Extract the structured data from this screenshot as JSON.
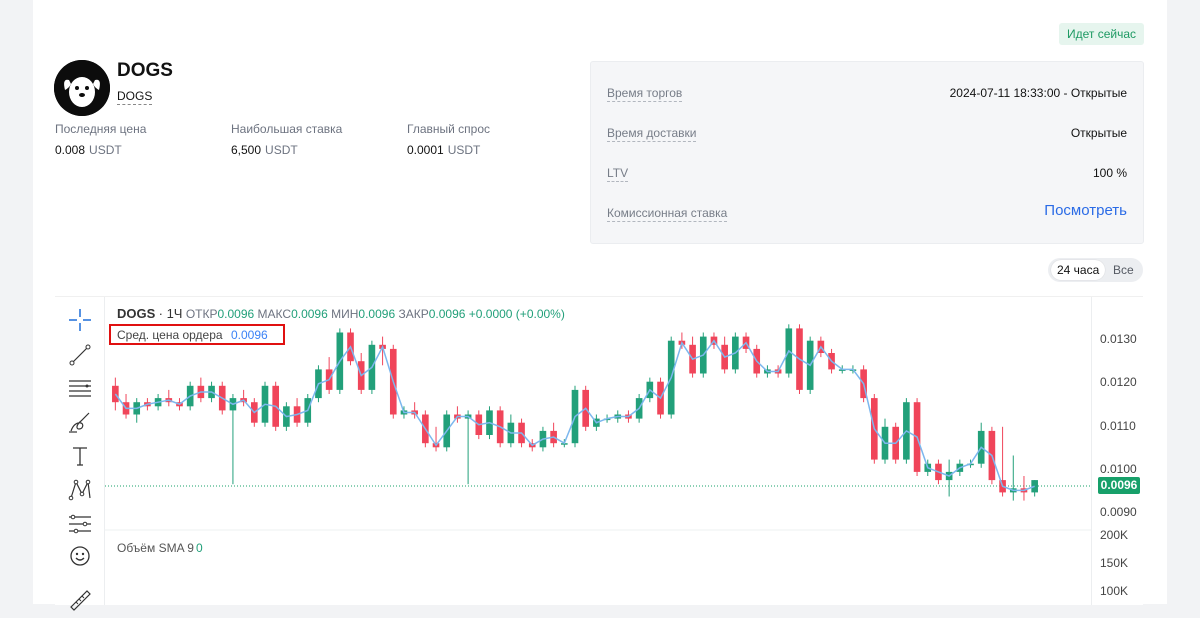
{
  "header": {
    "live_badge": "Идет сейчас",
    "token_name": "DOGS",
    "token_symbol": "DOGS"
  },
  "stats": [
    {
      "label": "Последняя цена",
      "value": "0.008",
      "unit": "USDT"
    },
    {
      "label": "Наибольшая ставка",
      "value": "6,500",
      "unit": "USDT"
    },
    {
      "label": "Главный спрос",
      "value": "0.0001",
      "unit": "USDT"
    }
  ],
  "info": {
    "trade_time_label": "Время торгов",
    "trade_time_value": "2024-07-11 18:33:00 - Открытые",
    "delivery_label": "Время доставки",
    "delivery_value": "Открытые",
    "ltv_label": "LTV",
    "ltv_value": "100 %",
    "fee_label": "Комиссионная ставка",
    "fee_link": "Посмотреть"
  },
  "range": {
    "options": [
      "24 часа",
      "Все"
    ],
    "selected": "24 часа"
  },
  "toolbar": {
    "icons": [
      "crosshair-icon",
      "trend-line-icon",
      "horizontal-lines-icon",
      "brush-icon",
      "text-icon",
      "pattern-icon",
      "forecast-icon",
      "emoji-icon",
      "ruler-icon"
    ]
  },
  "chart": {
    "symbol": "DOGS",
    "timeframe": "· 1Ч",
    "open_label": "ОТКР",
    "open": "0.0096",
    "high_label": "МАКС",
    "high": "0.0096",
    "low_label": "МИН",
    "low": "0.0096",
    "close_label": "ЗАКР",
    "close": "0.0096",
    "change": "+0.0000 (+0.00%)",
    "avg_label": "Сред. цена ордера",
    "avg_value": "0.0096",
    "volume_label": "Объём SMA 9",
    "volume_value": "0",
    "current_price_tag": "0.0096",
    "price_ticks": [
      "0.0130",
      "0.0120",
      "0.0110",
      "0.0100",
      "0.0090"
    ],
    "volume_ticks": [
      "200K",
      "150K",
      "100K"
    ],
    "colors": {
      "up": "#22a07a",
      "down": "#f0455a",
      "avg_line": "#7cb7ee",
      "price_line": "#17a06a"
    }
  },
  "chart_data": {
    "type": "candlestick",
    "ylim": [
      0.0087,
      0.0137
    ],
    "current_price": 0.0096,
    "candles": [
      [
        0.0119,
        0.0121,
        0.0113,
        0.0115
      ],
      [
        0.0115,
        0.0117,
        0.0111,
        0.0112
      ],
      [
        0.0112,
        0.0116,
        0.011,
        0.0115
      ],
      [
        0.0115,
        0.0116,
        0.0113,
        0.0114
      ],
      [
        0.0114,
        0.0117,
        0.0113,
        0.0116
      ],
      [
        0.0116,
        0.0118,
        0.0114,
        0.0115
      ],
      [
        0.0115,
        0.0116,
        0.0113,
        0.0114
      ],
      [
        0.0114,
        0.012,
        0.0113,
        0.0119
      ],
      [
        0.0119,
        0.0121,
        0.0115,
        0.0116
      ],
      [
        0.0116,
        0.012,
        0.0115,
        0.0119
      ],
      [
        0.0119,
        0.012,
        0.0112,
        0.0113
      ],
      [
        0.0113,
        0.0117,
        0.0095,
        0.0116
      ],
      [
        0.0116,
        0.0118,
        0.0114,
        0.0115
      ],
      [
        0.0115,
        0.0116,
        0.0109,
        0.011
      ],
      [
        0.011,
        0.012,
        0.0109,
        0.0119
      ],
      [
        0.0119,
        0.012,
        0.0108,
        0.0109
      ],
      [
        0.0109,
        0.0115,
        0.0108,
        0.0114
      ],
      [
        0.0114,
        0.0116,
        0.0109,
        0.011
      ],
      [
        0.011,
        0.0117,
        0.0109,
        0.0116
      ],
      [
        0.0116,
        0.0124,
        0.0115,
        0.0123
      ],
      [
        0.0123,
        0.0126,
        0.0117,
        0.0118
      ],
      [
        0.0118,
        0.0133,
        0.0117,
        0.0132
      ],
      [
        0.0132,
        0.0133,
        0.0124,
        0.0125
      ],
      [
        0.0125,
        0.0127,
        0.0117,
        0.0118
      ],
      [
        0.0118,
        0.013,
        0.0117,
        0.0129
      ],
      [
        0.0129,
        0.0131,
        0.0124,
        0.0128
      ],
      [
        0.0128,
        0.0129,
        0.0111,
        0.0112
      ],
      [
        0.0112,
        0.0114,
        0.0111,
        0.0113
      ],
      [
        0.0113,
        0.0115,
        0.0111,
        0.0112
      ],
      [
        0.0112,
        0.0113,
        0.0104,
        0.0105
      ],
      [
        0.0105,
        0.0109,
        0.0103,
        0.0104
      ],
      [
        0.0104,
        0.0113,
        0.0103,
        0.0112
      ],
      [
        0.0112,
        0.0114,
        0.011,
        0.0111
      ],
      [
        0.0111,
        0.0113,
        0.0095,
        0.0112
      ],
      [
        0.0112,
        0.0113,
        0.0106,
        0.0107
      ],
      [
        0.0107,
        0.0114,
        0.0106,
        0.0113
      ],
      [
        0.0113,
        0.0114,
        0.0104,
        0.0105
      ],
      [
        0.0105,
        0.0112,
        0.0104,
        0.011
      ],
      [
        0.011,
        0.0111,
        0.0104,
        0.0105
      ],
      [
        0.0105,
        0.0106,
        0.0103,
        0.0104
      ],
      [
        0.0104,
        0.0109,
        0.0103,
        0.0108
      ],
      [
        0.0108,
        0.011,
        0.0104,
        0.0105
      ],
      [
        0.0105,
        0.0106,
        0.0104,
        0.0105
      ],
      [
        0.0105,
        0.0119,
        0.0104,
        0.0118
      ],
      [
        0.0118,
        0.0119,
        0.0108,
        0.0109
      ],
      [
        0.0109,
        0.0112,
        0.0108,
        0.0111
      ],
      [
        0.0111,
        0.0112,
        0.011,
        0.0111
      ],
      [
        0.0111,
        0.0113,
        0.011,
        0.0112
      ],
      [
        0.0112,
        0.0113,
        0.011,
        0.0111
      ],
      [
        0.0111,
        0.0117,
        0.011,
        0.0116
      ],
      [
        0.0116,
        0.0121,
        0.0115,
        0.012
      ],
      [
        0.012,
        0.0121,
        0.0111,
        0.0112
      ],
      [
        0.0112,
        0.0131,
        0.0111,
        0.013
      ],
      [
        0.013,
        0.0132,
        0.0128,
        0.0129
      ],
      [
        0.0129,
        0.0131,
        0.0121,
        0.0122
      ],
      [
        0.0122,
        0.0132,
        0.0121,
        0.0131
      ],
      [
        0.0131,
        0.0132,
        0.0128,
        0.0129
      ],
      [
        0.0129,
        0.0131,
        0.0122,
        0.0123
      ],
      [
        0.0123,
        0.0132,
        0.0122,
        0.0131
      ],
      [
        0.0131,
        0.0132,
        0.0127,
        0.0128
      ],
      [
        0.0128,
        0.0129,
        0.0121,
        0.0122
      ],
      [
        0.0122,
        0.0124,
        0.0121,
        0.0123
      ],
      [
        0.0123,
        0.0124,
        0.0121,
        0.0122
      ],
      [
        0.0122,
        0.0134,
        0.0121,
        0.0133
      ],
      [
        0.0133,
        0.0134,
        0.0117,
        0.0118
      ],
      [
        0.0118,
        0.0131,
        0.0117,
        0.013
      ],
      [
        0.013,
        0.0131,
        0.0126,
        0.0127
      ],
      [
        0.0127,
        0.0128,
        0.0122,
        0.0123
      ],
      [
        0.0123,
        0.0124,
        0.0122,
        0.0123
      ],
      [
        0.0123,
        0.0124,
        0.0122,
        0.0123
      ],
      [
        0.0123,
        0.0124,
        0.0115,
        0.0116
      ],
      [
        0.0116,
        0.0117,
        0.01,
        0.0101
      ],
      [
        0.0101,
        0.0111,
        0.01,
        0.0109
      ],
      [
        0.0109,
        0.011,
        0.01,
        0.0101
      ],
      [
        0.0101,
        0.0116,
        0.01,
        0.0115
      ],
      [
        0.0115,
        0.0116,
        0.0097,
        0.0098
      ],
      [
        0.0098,
        0.0101,
        0.0097,
        0.01
      ],
      [
        0.01,
        0.0101,
        0.0095,
        0.0096
      ],
      [
        0.0096,
        0.0101,
        0.0092,
        0.0098
      ],
      [
        0.0098,
        0.0101,
        0.0097,
        0.01
      ],
      [
        0.01,
        0.0101,
        0.0099,
        0.01
      ],
      [
        0.01,
        0.011,
        0.0099,
        0.0108
      ],
      [
        0.0108,
        0.0109,
        0.0095,
        0.0096
      ],
      [
        0.0096,
        0.0109,
        0.0092,
        0.0093
      ],
      [
        0.0093,
        0.0102,
        0.0091,
        0.0094
      ],
      [
        0.0094,
        0.0097,
        0.0091,
        0.0093
      ],
      [
        0.0093,
        0.0096,
        0.0092,
        0.0096
      ]
    ],
    "volume": [
      0,
      0,
      0,
      0,
      0,
      0,
      0,
      0,
      0,
      0,
      0,
      0,
      0,
      0,
      0,
      0,
      0,
      0,
      0,
      0,
      0,
      0,
      0,
      0,
      0,
      0,
      0,
      0,
      0,
      0,
      0,
      0,
      0,
      0,
      0,
      0,
      0,
      0,
      0,
      0,
      0,
      0,
      0,
      0,
      0,
      0,
      0,
      0,
      0,
      0,
      0,
      0,
      0,
      0,
      0,
      0,
      0,
      0,
      0,
      0,
      0,
      0,
      0,
      0,
      0,
      0,
      0,
      0,
      0,
      0,
      0,
      0,
      0,
      0,
      0,
      0,
      0,
      0,
      0,
      0,
      0,
      0,
      0,
      0,
      0,
      0,
      0,
      0
    ],
    "volume_ylim": [
      0,
      220000
    ]
  }
}
